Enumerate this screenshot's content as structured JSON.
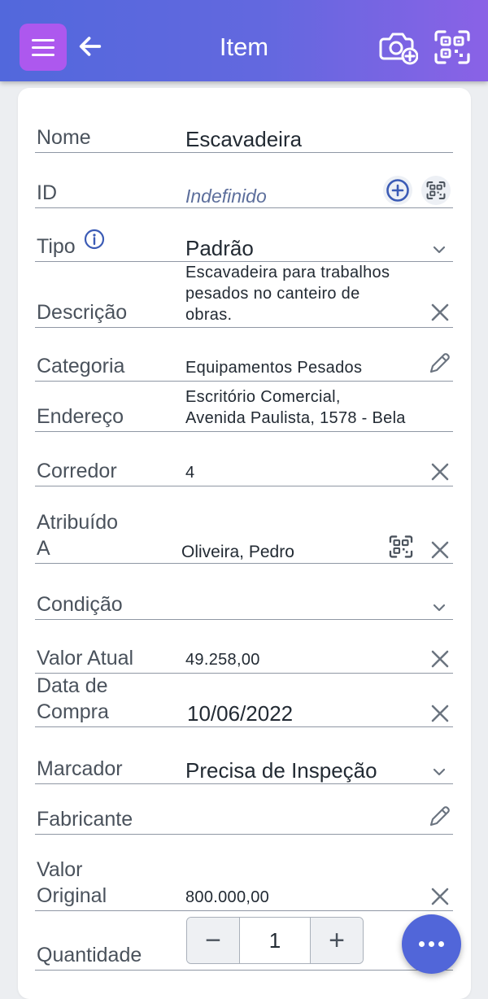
{
  "header": {
    "title": "Item"
  },
  "fields": {
    "nome": {
      "label": "Nome",
      "value": "Escavadeira"
    },
    "id": {
      "label": "ID",
      "value": "Indefinido"
    },
    "tipo": {
      "label": "Tipo",
      "value": "Padrão"
    },
    "descricao": {
      "label": "Descrição",
      "value_lines": [
        "Escavadeira para trabalhos",
        "pesados no canteiro de",
        "obras."
      ]
    },
    "categoria": {
      "label": "Categoria",
      "value": "Equipamentos Pesados"
    },
    "endereco": {
      "label": "Endereço",
      "value_lines": [
        "Escritório Comercial,",
        "Avenida Paulista, 1578 - Bela"
      ]
    },
    "corredor": {
      "label": "Corredor",
      "value": "4"
    },
    "atribuido": {
      "label_lines": [
        "Atribuído",
        "A"
      ],
      "value": "Oliveira, Pedro"
    },
    "condicao": {
      "label": "Condição",
      "value": ""
    },
    "valor_atual": {
      "label": "Valor Atual",
      "value": "49.258,00"
    },
    "data_compra": {
      "label_lines": [
        "Data de",
        "Compra"
      ],
      "value": "10/06/2022"
    },
    "marcador": {
      "label": "Marcador",
      "value": "Precisa de Inspeção"
    },
    "fabricante": {
      "label": "Fabricante",
      "value": ""
    },
    "valor_original": {
      "label_lines": [
        "Valor",
        "Original"
      ],
      "value": "800.000,00"
    },
    "quantidade": {
      "label": "Quantidade",
      "value": "1",
      "minus": "−",
      "plus": "+"
    }
  },
  "icons": {
    "menu": "hamburger-menu-icon",
    "back": "arrow-left-icon",
    "add_photo": "camera-add-icon",
    "scan": "qr-scan-icon",
    "info": "info-icon",
    "add": "plus-circle-icon",
    "clear": "close-icon",
    "dropdown": "chevron-down-icon",
    "edit": "pencil-icon",
    "more": "more-horizontal-icon"
  },
  "colors": {
    "header_start": "#5268dc",
    "header_end": "#8a62e6",
    "menu_button": "#ad58ee",
    "fab": "#5166d9",
    "accent_icon": "#3b5bb5"
  }
}
